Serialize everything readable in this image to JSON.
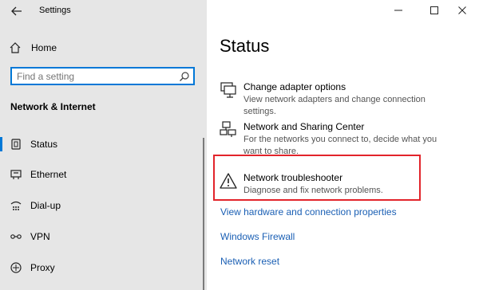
{
  "window": {
    "title": "Settings",
    "controls": [
      "minimize",
      "maximize",
      "close"
    ]
  },
  "sidebar": {
    "home_label": "Home",
    "search_placeholder": "Find a setting",
    "section_title": "Network & Internet",
    "items": [
      {
        "label": "Status",
        "icon": "status-icon",
        "active": true
      },
      {
        "label": "Ethernet",
        "icon": "ethernet-icon",
        "active": false
      },
      {
        "label": "Dial-up",
        "icon": "dialup-icon",
        "active": false
      },
      {
        "label": "VPN",
        "icon": "vpn-icon",
        "active": false
      },
      {
        "label": "Proxy",
        "icon": "proxy-icon",
        "active": false
      }
    ]
  },
  "main": {
    "title": "Status",
    "entries": [
      {
        "title": "Change adapter options",
        "description": "View network adapters and change connection settings.",
        "icon": "adapter-icon"
      },
      {
        "title": "Network and Sharing Center",
        "description": "For the networks you connect to, decide what you want to share.",
        "icon": "sharing-center-icon"
      },
      {
        "title": "Network troubleshooter",
        "description": "Diagnose and fix network problems.",
        "icon": "warning-icon"
      }
    ],
    "links": [
      "View hardware and connection properties",
      "Windows Firewall",
      "Network reset"
    ]
  },
  "colors": {
    "accent": "#0078d7",
    "highlight": "#e2242b",
    "link": "#1a5fb4",
    "sidebar_bg": "#e6e6e6"
  }
}
